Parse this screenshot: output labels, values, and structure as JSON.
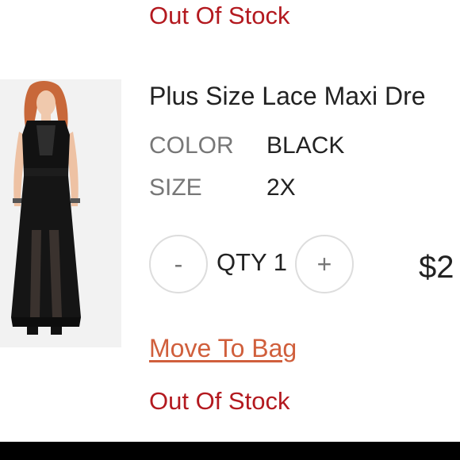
{
  "top_item": {
    "stock_status": "Out Of Stock"
  },
  "item": {
    "image_alt": "woman in black lace maxi dress",
    "name": "Plus Size Lace Maxi Dre",
    "color_label": "COLOR",
    "color_value": "BLACK",
    "size_label": "SIZE",
    "size_value": "2X",
    "qty_minus": "-",
    "qty_label": "QTY 1",
    "qty_plus": "+",
    "price": "$2",
    "move_link": "Move To Bag",
    "stock_status": "Out Of Stock"
  },
  "colors": {
    "stock_red": "#b3191f",
    "link_orange": "#d05f3c",
    "label_gray": "#777777",
    "text_dark": "#222222"
  }
}
